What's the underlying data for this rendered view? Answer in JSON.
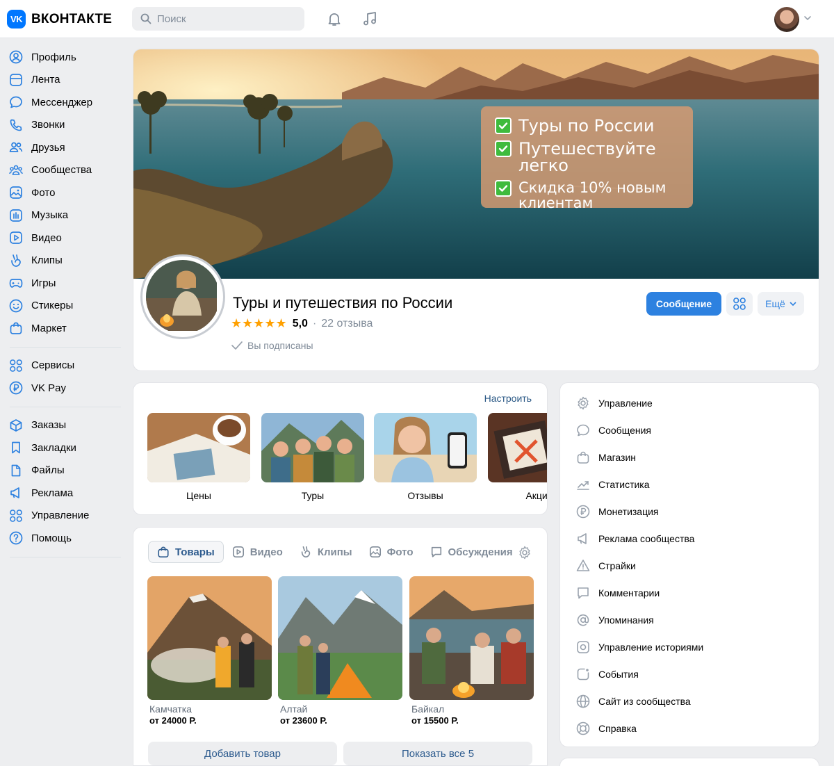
{
  "header": {
    "logo_mark": "VK",
    "logo_text": "ВКОНТАКТЕ",
    "search_placeholder": "Поиск"
  },
  "sidebar": {
    "group1": [
      {
        "label": "Профиль",
        "icon": "user-icon"
      },
      {
        "label": "Лента",
        "icon": "feed-icon"
      },
      {
        "label": "Мессенджер",
        "icon": "chat-icon"
      },
      {
        "label": "Звонки",
        "icon": "phone-icon"
      },
      {
        "label": "Друзья",
        "icon": "friends-icon"
      },
      {
        "label": "Сообщества",
        "icon": "communities-icon"
      },
      {
        "label": "Фото",
        "icon": "photo-icon"
      },
      {
        "label": "Музыка",
        "icon": "music-icon"
      },
      {
        "label": "Видео",
        "icon": "video-icon"
      },
      {
        "label": "Клипы",
        "icon": "clips-icon"
      },
      {
        "label": "Игры",
        "icon": "gamepad-icon"
      },
      {
        "label": "Стикеры",
        "icon": "smile-icon"
      },
      {
        "label": "Маркет",
        "icon": "bag-icon"
      }
    ],
    "group2": [
      {
        "label": "Сервисы",
        "icon": "grid-icon"
      },
      {
        "label": "VK Pay",
        "icon": "ruble-icon"
      }
    ],
    "group3": [
      {
        "label": "Заказы",
        "icon": "box-icon"
      },
      {
        "label": "Закладки",
        "icon": "bookmark-icon"
      },
      {
        "label": "Файлы",
        "icon": "file-icon"
      },
      {
        "label": "Реклама",
        "icon": "megaphone-icon"
      },
      {
        "label": "Управление",
        "icon": "grid-icon"
      },
      {
        "label": "Помощь",
        "icon": "help-icon"
      }
    ]
  },
  "cover": {
    "promo": [
      "Туры по России",
      "Путешествуйте легко",
      "Скидка 10% новым клиентам"
    ]
  },
  "community": {
    "title": "Туры и путешествия по России",
    "stars": "★★★★★",
    "rating": "5,0",
    "reviews": "22 отзыва",
    "subscribed": "Вы подписаны",
    "message_button": "Сообщение",
    "more_button": "Ещё"
  },
  "shortcuts": {
    "configure": "Настроить",
    "items": [
      {
        "label": "Цены"
      },
      {
        "label": "Туры"
      },
      {
        "label": "Отзывы"
      },
      {
        "label": "Акции"
      }
    ]
  },
  "goods": {
    "tabs": [
      "Товары",
      "Видео",
      "Клипы",
      "Фото",
      "Обсуждения"
    ],
    "products": [
      {
        "name": "Камчатка",
        "price": "от 24000 Р."
      },
      {
        "name": "Алтай",
        "price": "от 23600 Р."
      },
      {
        "name": "Байкал",
        "price": "от 15500 Р."
      }
    ],
    "add_button": "Добавить товар",
    "show_all_button": "Показать все 5"
  },
  "right_menu": [
    {
      "label": "Управление",
      "icon": "gear-icon"
    },
    {
      "label": "Сообщения",
      "icon": "message-icon"
    },
    {
      "label": "Магазин",
      "icon": "bag-icon"
    },
    {
      "label": "Статистика",
      "icon": "stats-icon"
    },
    {
      "label": "Монетизация",
      "icon": "ruble-icon"
    },
    {
      "label": "Реклама сообщества",
      "icon": "megaphone-icon"
    },
    {
      "label": "Страйки",
      "icon": "warning-icon"
    },
    {
      "label": "Комментарии",
      "icon": "comment-icon"
    },
    {
      "label": "Упоминания",
      "icon": "at-icon"
    },
    {
      "label": "Управление историями",
      "icon": "stories-icon"
    },
    {
      "label": "События",
      "icon": "event-icon"
    },
    {
      "label": "Сайт из сообщества",
      "icon": "globe-icon"
    },
    {
      "label": "Справка",
      "icon": "lifebuoy-icon"
    }
  ],
  "colors": {
    "accent": "#2d81e0",
    "brand": "#0077ff",
    "background": "#edeef0",
    "star": "#ffa000"
  }
}
